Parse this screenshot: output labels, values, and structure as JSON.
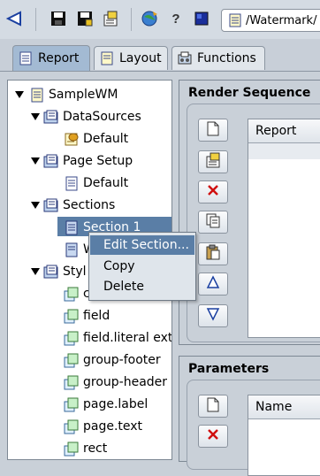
{
  "toolbar": {
    "icons": [
      "back-arrow-icon",
      "save-icon",
      "save-as-icon",
      "properties-icon",
      "globe-icon",
      "help-icon",
      "preview-icon"
    ],
    "path_value": "/Watermark/"
  },
  "tabs": [
    {
      "label": "Report",
      "icon": "report-icon",
      "active": true
    },
    {
      "label": "Layout",
      "icon": "layout-icon",
      "active": false
    },
    {
      "label": "Functions",
      "icon": "functions-icon",
      "active": false
    }
  ],
  "tree": [
    {
      "label": "SampleWM",
      "icon": "report-doc-icon",
      "level": 0,
      "expanded": true
    },
    {
      "label": "DataSources",
      "icon": "folder-icon",
      "level": 1,
      "expanded": true
    },
    {
      "label": "Default",
      "icon": "datasource-icon",
      "level": 2
    },
    {
      "label": "Page Setup",
      "icon": "folder-icon",
      "level": 1,
      "expanded": true
    },
    {
      "label": "Default",
      "icon": "page-icon",
      "level": 2
    },
    {
      "label": "Sections",
      "icon": "folder-icon",
      "level": 1,
      "expanded": true
    },
    {
      "label": "Section 1",
      "icon": "section-icon",
      "level": 2,
      "selected": true
    },
    {
      "label": "W",
      "icon": "section-icon",
      "level": 2
    },
    {
      "label": "Styl",
      "icon": "folder-icon",
      "level": 1,
      "expanded": true
    },
    {
      "label": "c",
      "icon": "style-icon",
      "level": 2
    },
    {
      "label": "field",
      "icon": "style-icon",
      "level": 2
    },
    {
      "label": "field.literal exte",
      "icon": "style-icon",
      "level": 2
    },
    {
      "label": "group-footer",
      "icon": "style-icon",
      "level": 2
    },
    {
      "label": "group-header",
      "icon": "style-icon",
      "level": 2
    },
    {
      "label": "page.label",
      "icon": "style-icon",
      "level": 2
    },
    {
      "label": "page.text",
      "icon": "style-icon",
      "level": 2
    },
    {
      "label": "rect",
      "icon": "style-icon",
      "level": 2
    }
  ],
  "render_sequence": {
    "title": "Render Sequence",
    "column_header": "Report",
    "buttons": [
      "new-page-icon",
      "edit-properties-icon",
      "delete-x-icon",
      "copy-icon",
      "paste-icon",
      "move-up-icon",
      "move-down-icon"
    ]
  },
  "parameters": {
    "title": "Parameters",
    "column_header": "Name",
    "buttons": [
      "new-page-icon",
      "delete-x-icon"
    ]
  },
  "context_menu": {
    "items": [
      "Edit Section...",
      "Copy",
      "Delete"
    ],
    "highlighted": 0
  },
  "colors": {
    "selection": "#5a7ea6",
    "active_tab": "#a3bad3",
    "delete": "#d01010"
  }
}
